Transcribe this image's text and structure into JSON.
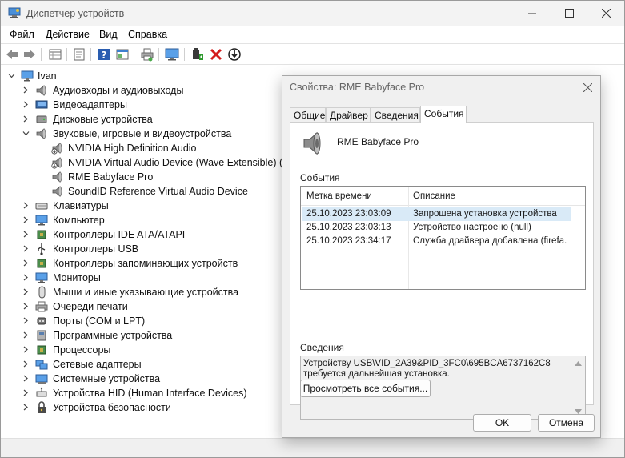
{
  "window": {
    "title": "Диспетчер устройств"
  },
  "menu": [
    "Файл",
    "Действие",
    "Вид",
    "Справка"
  ],
  "toolbar_icons": [
    "back-arrow-icon",
    "forward-arrow-icon",
    "properties-grid-icon",
    "document-icon",
    "help-icon",
    "view-icon",
    "printer-icon",
    "monitor-icon",
    "driver-update-icon",
    "remove-x-icon",
    "download-arrow-icon"
  ],
  "tree": {
    "root": "Ivan",
    "categories": [
      {
        "label": "Аудиовходы и аудиовыходы",
        "expanded": false
      },
      {
        "label": "Видеоадаптеры",
        "expanded": false
      },
      {
        "label": "Дисковые устройства",
        "expanded": false
      },
      {
        "label": "Звуковые, игровые и видеоустройства",
        "expanded": true,
        "children": [
          "NVIDIA High Definition Audio",
          "NVIDIA Virtual Audio Device (Wave Extensible) (WD",
          "RME Babyface Pro",
          "SoundID Reference Virtual Audio Device"
        ]
      },
      {
        "label": "Клавиатуры",
        "expanded": false
      },
      {
        "label": "Компьютер",
        "expanded": false
      },
      {
        "label": "Контроллеры IDE ATA/ATAPI",
        "expanded": false
      },
      {
        "label": "Контроллеры USB",
        "expanded": false
      },
      {
        "label": "Контроллеры запоминающих устройств",
        "expanded": false
      },
      {
        "label": "Мониторы",
        "expanded": false
      },
      {
        "label": "Мыши и иные указывающие устройства",
        "expanded": false
      },
      {
        "label": "Очереди печати",
        "expanded": false
      },
      {
        "label": "Порты (COM и LPT)",
        "expanded": false
      },
      {
        "label": "Программные устройства",
        "expanded": false
      },
      {
        "label": "Процессоры",
        "expanded": false
      },
      {
        "label": "Сетевые адаптеры",
        "expanded": false
      },
      {
        "label": "Системные устройства",
        "expanded": false
      },
      {
        "label": "Устройства HID (Human Interface Devices)",
        "expanded": false
      },
      {
        "label": "Устройства безопасности",
        "expanded": false
      }
    ]
  },
  "dialog": {
    "title": "Свойства: RME Babyface Pro",
    "tabs": [
      "Общие",
      "Драйвер",
      "Сведения",
      "События"
    ],
    "active_tab": "События",
    "device_name": "RME Babyface Pro",
    "events_label": "События",
    "columns": [
      "Метка времени",
      "Описание"
    ],
    "events": [
      {
        "time": "25.10.2023 23:03:09",
        "desc": "Запрошена установка устройства",
        "selected": true
      },
      {
        "time": "25.10.2023 23:03:13",
        "desc": "Устройство настроено (null)",
        "selected": false
      },
      {
        "time": "25.10.2023 23:34:17",
        "desc": "Служба драйвера добавлена (firefa...",
        "selected": false
      }
    ],
    "details_label": "Сведения",
    "details_text": "Устройству USB\\VID_2A39&PID_3FC0\\695BCA6737162C8\nтребуется дальнейшая установка.",
    "view_all_button": "Просмотреть все события...",
    "ok_button": "OK",
    "cancel_button": "Отмена"
  },
  "colors": {
    "selection": "#d9eaf7",
    "accent_blue": "#1e63c5",
    "remove_red": "#d41c1c"
  }
}
